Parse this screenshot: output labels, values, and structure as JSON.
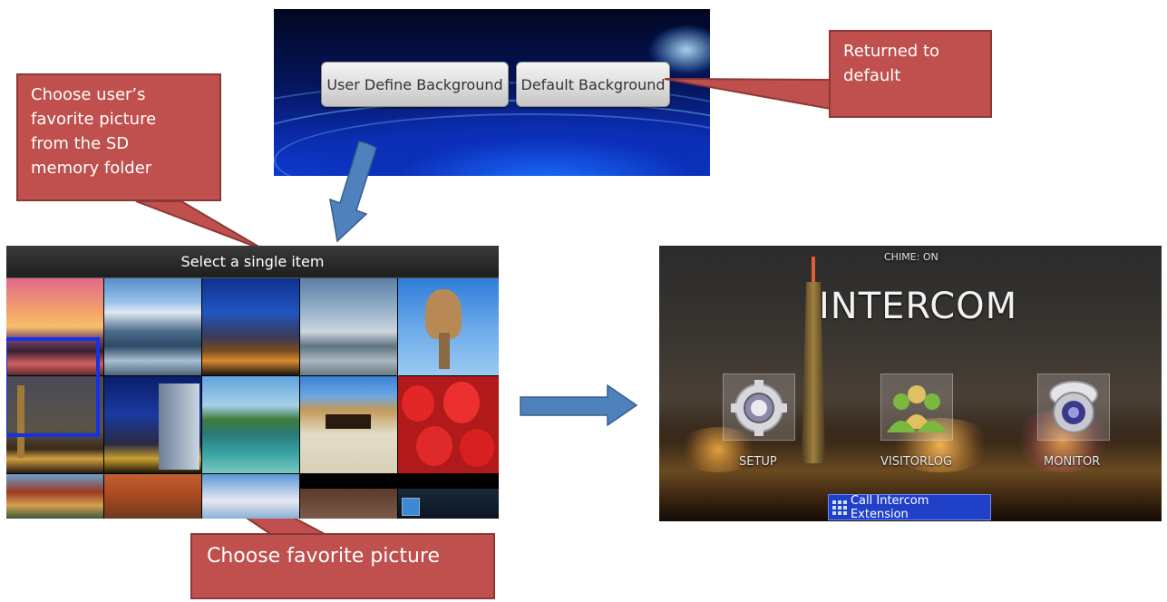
{
  "top_panel": {
    "user_define_label": "User Define Background",
    "default_label": "Default Background"
  },
  "callouts": {
    "choose_user": "Choose user’s\nfavorite picture\nfrom the SD\nmemory folder",
    "returned": "Returned to\ndefault",
    "choose_favorite": "Choose favorite picture"
  },
  "gallery": {
    "title": "Select a single item"
  },
  "intercom": {
    "chime": "CHIME: ON",
    "title": "INTERCOM",
    "setup_label": "SETUP",
    "visitorlog_label": "VISITORLOG",
    "monitor_label": "MONITOR",
    "call_label": "Call Intercom Extension"
  },
  "colors": {
    "callout": "#c0504d",
    "arrow": "#4f81bd",
    "selection": "#1531e8"
  }
}
